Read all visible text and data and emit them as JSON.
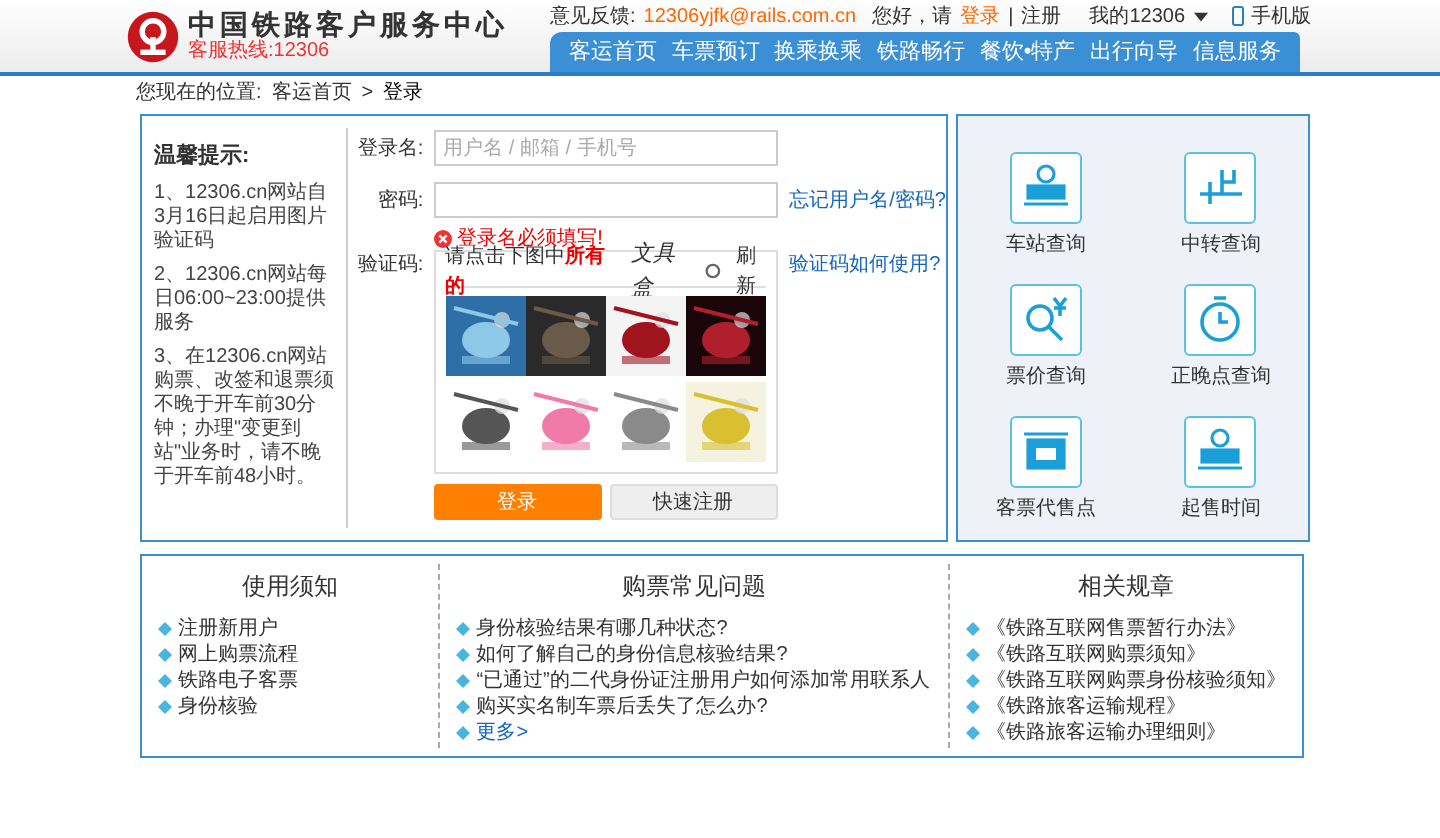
{
  "header": {
    "title": "中国铁路客户服务中心",
    "hotline": "客服热线:12306",
    "feedback_label": "意见反馈:",
    "feedback_email": "12306yjfk@rails.com.cn",
    "greeting": "您好，请",
    "login_link": "登录",
    "separator": "|",
    "register_link": "注册",
    "my_account": "我的12306",
    "mobile": "手机版"
  },
  "nav": [
    "客运首页",
    "车票预订",
    "换乘换乘",
    "铁路畅行",
    "餐饮•特产",
    "出行向导",
    "信息服务"
  ],
  "breadcrumb": {
    "label": "您现在的位置:",
    "items": [
      "客运首页",
      "登录"
    ],
    "separator": ">"
  },
  "tips": {
    "title": "温馨提示:",
    "items": [
      "1、12306.cn网站自3月16日起启用图片验证码",
      "2、12306.cn网站每日06:00~23:00提供服务",
      "3、在12306.cn网站购票、改签和退票须不晚于开车前30分钟；办理\"变更到站\"业务时，请不晚于开车前48小时。"
    ]
  },
  "form": {
    "username_label": "登录名:",
    "username_placeholder": "用户名 / 邮箱 / 手机号",
    "password_label": "密码:",
    "forgot_link": "忘记用户名/密码?",
    "error": "登录名必须填写!",
    "captcha_label": "验证码:",
    "captcha_help_link": "验证码如何使用?",
    "captcha_prompt": "请点击下图中**所有的**",
    "captcha_word": "文具盒",
    "refresh": "刷新",
    "login_button": "登录",
    "register_button": "快速注册"
  },
  "services": [
    {
      "label": "车站查询",
      "kind": "station"
    },
    {
      "label": "中转查询",
      "kind": "transfer"
    },
    {
      "label": "票价查询",
      "kind": "price"
    },
    {
      "label": "正晚点查询",
      "kind": "clock"
    },
    {
      "label": "客票代售点",
      "kind": "ticket"
    },
    {
      "label": "起售时间",
      "kind": "station"
    }
  ],
  "info": [
    {
      "title": "使用须知",
      "links": [
        "注册新用户",
        "网上购票流程",
        "铁路电子客票",
        "身份核验"
      ]
    },
    {
      "title": "购票常见问题",
      "links": [
        "身份核验结果有哪几种状态?",
        "如何了解自己的身份信息核验结果?",
        "“已通过”的二代身份证注册用户如何添加常用联系人",
        "购买实名制车票后丢失了怎么办?"
      ],
      "more": "更多>"
    },
    {
      "title": "相关规章",
      "links": [
        "《铁路互联网售票暂行办法》",
        "《铁路互联网购票须知》",
        "《铁路互联网购票身份核验须知》",
        "《铁路旅客运输规程》",
        "《铁路旅客运输办理细则》"
      ]
    }
  ]
}
